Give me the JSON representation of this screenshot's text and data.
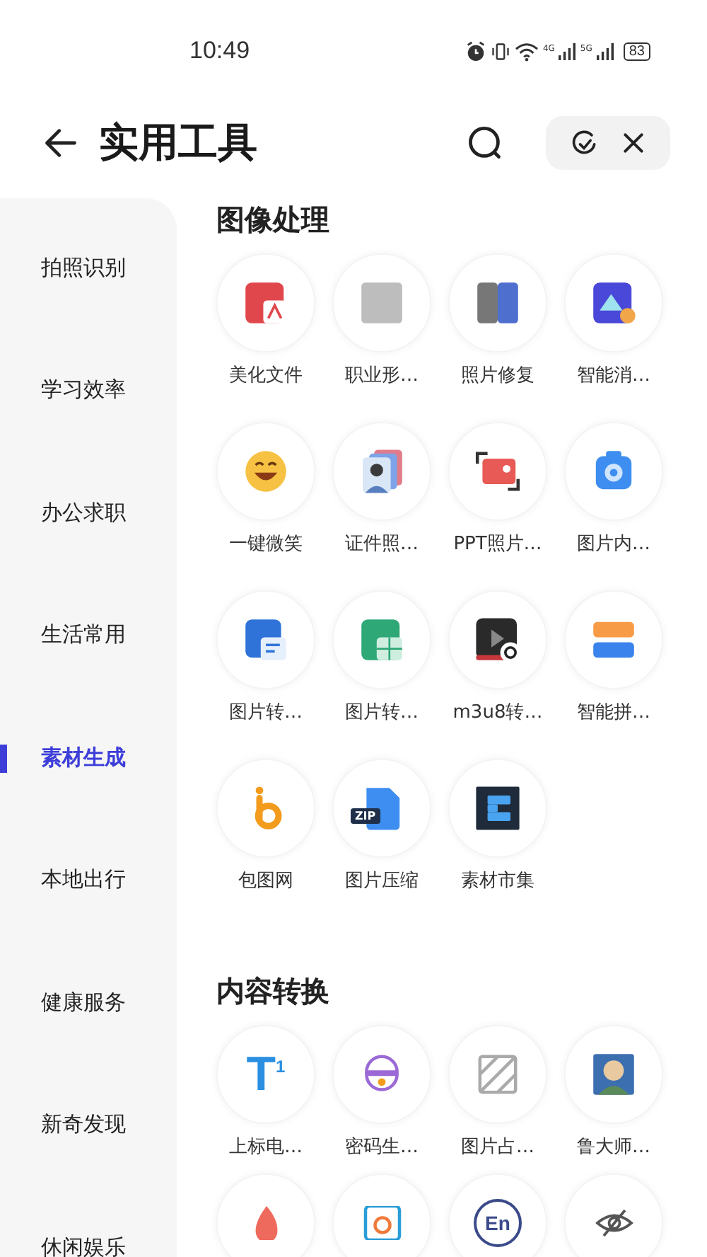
{
  "status_bar": {
    "time": "10:49",
    "network_1": "4G",
    "network_2": "5G",
    "battery": "83"
  },
  "header": {
    "title": "实用工具"
  },
  "sidebar": {
    "items": [
      {
        "label": "拍照识别",
        "selected": false
      },
      {
        "label": "学习效率",
        "selected": false
      },
      {
        "label": "办公求职",
        "selected": false
      },
      {
        "label": "生活常用",
        "selected": false
      },
      {
        "label": "素材生成",
        "selected": true
      },
      {
        "label": "本地出行",
        "selected": false
      },
      {
        "label": "健康服务",
        "selected": false
      },
      {
        "label": "新奇发现",
        "selected": false
      },
      {
        "label": "休闲娱乐",
        "selected": false
      }
    ]
  },
  "sections": [
    {
      "title": "图像处理",
      "tools": [
        {
          "label": "美化文件"
        },
        {
          "label": "职业形…"
        },
        {
          "label": "照片修复"
        },
        {
          "label": "智能消…"
        },
        {
          "label": "一键微笑"
        },
        {
          "label": "证件照…"
        },
        {
          "label": "PPT照片…"
        },
        {
          "label": "图片内…"
        },
        {
          "label": "图片转…"
        },
        {
          "label": "图片转…"
        },
        {
          "label": "m3u8转…"
        },
        {
          "label": "智能拼…"
        },
        {
          "label": "包图网"
        },
        {
          "label": "图片压缩",
          "badge": "ZIP"
        },
        {
          "label": "素材市集"
        }
      ]
    },
    {
      "title": "内容转换",
      "tools": [
        {
          "label": "上标电…",
          "glyph": "T$^{1}$"
        },
        {
          "label": "密码生…"
        },
        {
          "label": "图片占…"
        },
        {
          "label": "鲁大师…"
        },
        {
          "cut_off": true
        },
        {
          "cut_off": true
        },
        {
          "glyph": "En",
          "cut_off": true
        },
        {
          "cut_off": true
        }
      ]
    }
  ]
}
